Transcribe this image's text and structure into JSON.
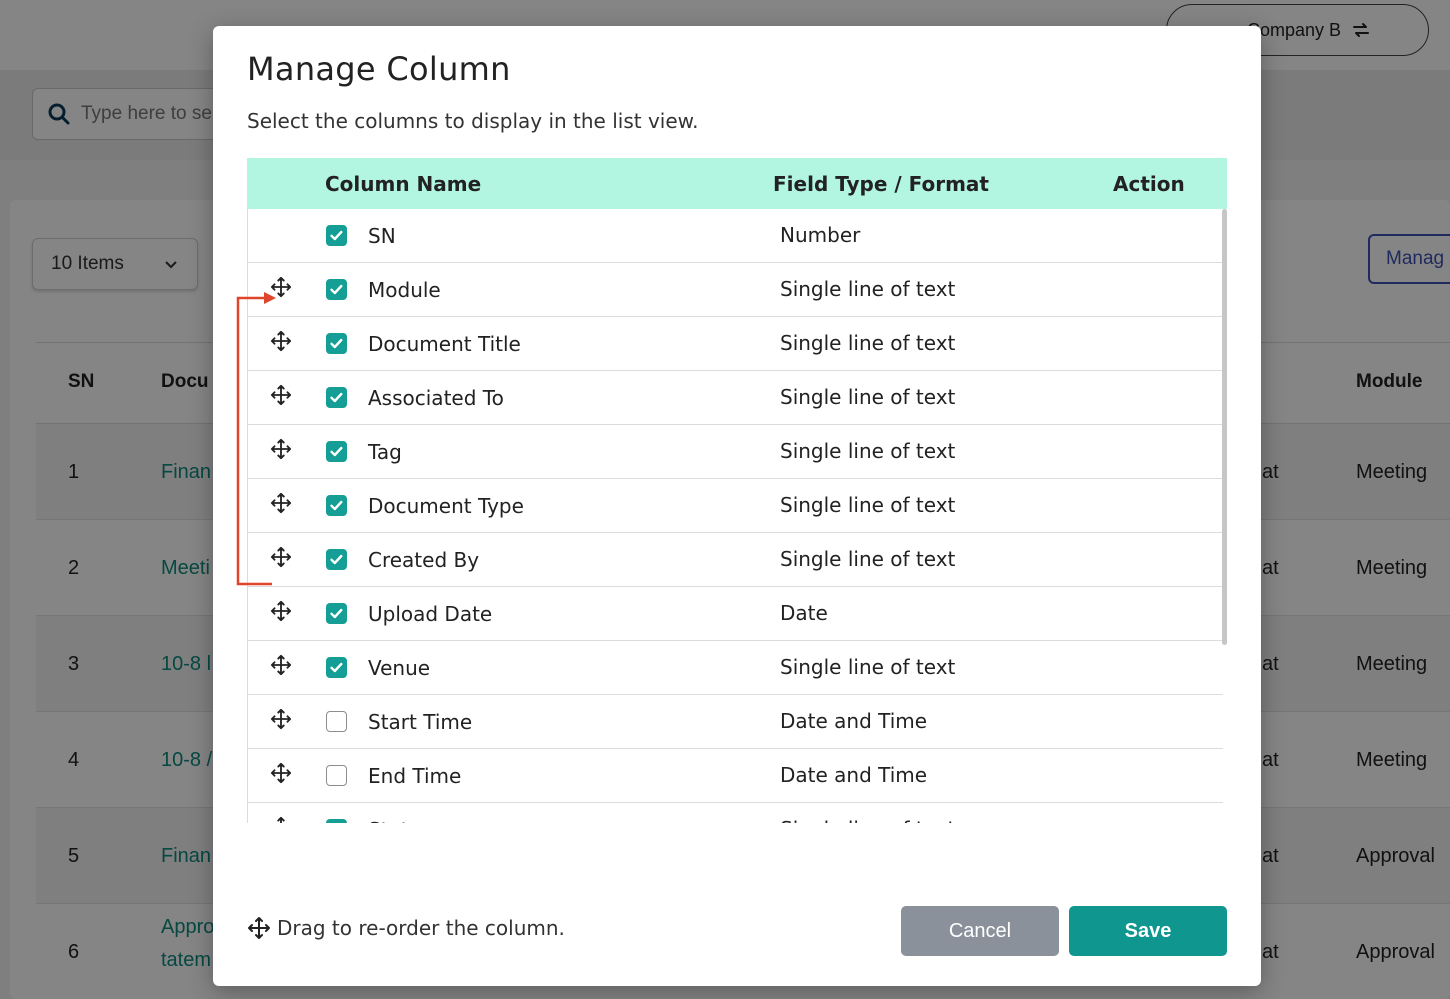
{
  "background": {
    "company": "Company B",
    "search_placeholder": "Type here to se",
    "items_select": "10 Items",
    "manage_button": "Manag",
    "table_headers": {
      "sn": "SN",
      "doc": "Docu",
      "module": "Module"
    },
    "rows": [
      {
        "sn": "1",
        "doc": "Finan",
        "mid": "at",
        "module": "Meeting"
      },
      {
        "sn": "2",
        "doc": "Meeti",
        "mid": "at",
        "module": "Meeting"
      },
      {
        "sn": "3",
        "doc": "10-8 l",
        "mid": "at",
        "module": "Meeting"
      },
      {
        "sn": "4",
        "doc": "10-8 /",
        "mid": "at",
        "module": "Meeting"
      },
      {
        "sn": "5",
        "doc": "Finan",
        "mid": "at",
        "module": "Approval"
      },
      {
        "sn": "6",
        "doc": "Appro",
        "doc2": "tatem",
        "mid": "at",
        "module": "Approval"
      }
    ]
  },
  "modal": {
    "title": "Manage Column",
    "subtitle": "Select the columns to display in the list view.",
    "headers": {
      "column_name": "Column Name",
      "field_type": "Field Type / Format",
      "action": "Action"
    },
    "columns": [
      {
        "name": "SN",
        "type": "Number",
        "checked": true,
        "draggable": false
      },
      {
        "name": "Module",
        "type": "Single line of text",
        "checked": true,
        "draggable": true
      },
      {
        "name": "Document Title",
        "type": "Single line of text",
        "checked": true,
        "draggable": true
      },
      {
        "name": "Associated To",
        "type": "Single line of text",
        "checked": true,
        "draggable": true
      },
      {
        "name": "Tag",
        "type": "Single line of text",
        "checked": true,
        "draggable": true
      },
      {
        "name": "Document Type",
        "type": "Single line of text",
        "checked": true,
        "draggable": true
      },
      {
        "name": "Created By",
        "type": "Single line of text",
        "checked": true,
        "draggable": true
      },
      {
        "name": "Upload Date",
        "type": "Date",
        "checked": true,
        "draggable": true
      },
      {
        "name": "Venue",
        "type": "Single line of text",
        "checked": true,
        "draggable": true
      },
      {
        "name": "Start Time",
        "type": "Date and Time",
        "checked": false,
        "draggable": true
      },
      {
        "name": "End Time",
        "type": "Date and Time",
        "checked": false,
        "draggable": true
      },
      {
        "name": "Status",
        "type": "Single line of text",
        "checked": true,
        "draggable": true
      }
    ],
    "hint": "Drag to re-order the column.",
    "cancel_label": "Cancel",
    "save_label": "Save"
  },
  "colors": {
    "accent": "#0e968f",
    "header_bg": "#b2f5e0",
    "annotation": "#e0442a"
  }
}
